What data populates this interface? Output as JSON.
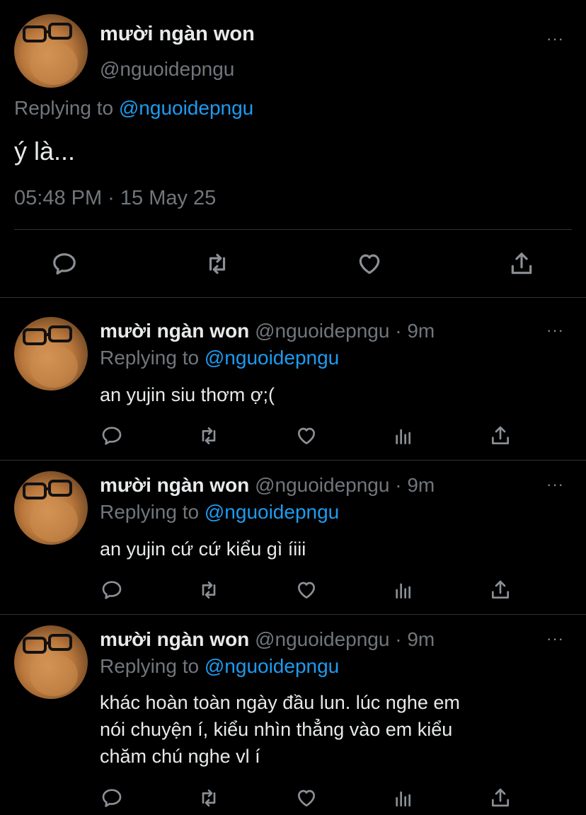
{
  "main_tweet": {
    "display_name": "mười ngàn won",
    "handle": "@nguoidepngu",
    "replying_prefix": "Replying to",
    "replying_to": "@nguoidepngu",
    "text": "ý là...",
    "timestamp": "05:48 PM · 15 May 25",
    "more_icon": "···"
  },
  "replies": [
    {
      "display_name": "mười ngàn won",
      "handle": "@nguoidepngu",
      "separator": "·",
      "time": "9m",
      "replying_prefix": "Replying to",
      "replying_to": "@nguoidepngu",
      "text": "an yujin siu thơm ợ;(",
      "more_icon": "···"
    },
    {
      "display_name": "mười ngàn won",
      "handle": "@nguoidepngu",
      "separator": "·",
      "time": "9m",
      "replying_prefix": "Replying to",
      "replying_to": "@nguoidepngu",
      "text": "an yujin cứ cứ kiểu gì íiii",
      "more_icon": "···"
    },
    {
      "display_name": "mười ngàn won",
      "handle": "@nguoidepngu",
      "separator": "·",
      "time": "9m",
      "replying_prefix": "Replying to",
      "replying_to": "@nguoidepngu",
      "text": "khác hoàn toàn ngày đầu lun. lúc nghe em\nnói chuyện í, kiểu nhìn thẳng vào em kiểu\nchăm chú nghe vl í",
      "more_icon": "···"
    }
  ],
  "action_icons": [
    "reply-icon",
    "retweet-icon",
    "like-icon",
    "analytics-icon",
    "share-icon"
  ],
  "colors": {
    "background": "#000000",
    "text": "#e7e9ea",
    "muted": "#71767b",
    "link": "#1d9bf0",
    "divider": "#2f3336"
  }
}
